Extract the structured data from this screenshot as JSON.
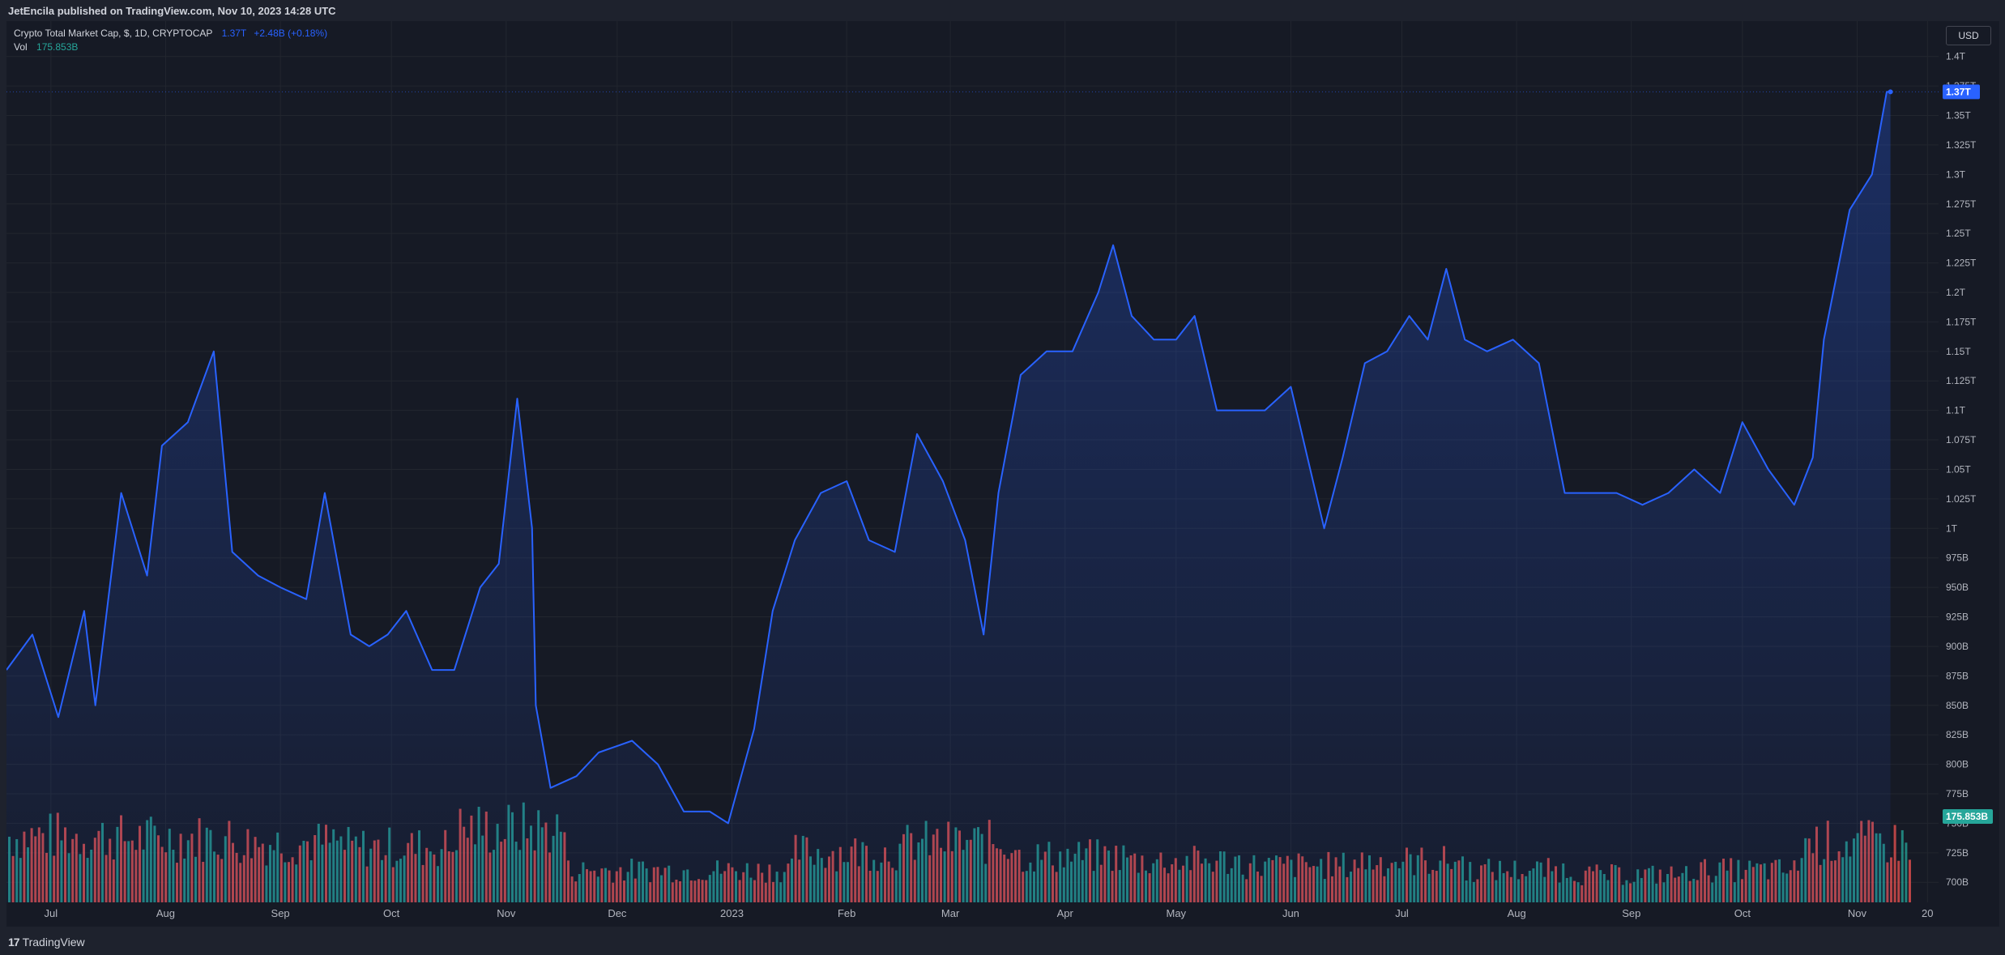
{
  "header": {
    "publish_text": "JetEncila published on TradingView.com, Nov 10, 2023 14:28 UTC"
  },
  "legend": {
    "symbol": "Crypto Total Market Cap, $, 1D, CRYPTOCAP",
    "price": "1.37T",
    "change": "+2.48B (+0.18%)",
    "vol_label": "Vol",
    "vol_value": "175.853B"
  },
  "controls": {
    "currency": "USD"
  },
  "footer": {
    "brand": "TradingView",
    "brand_mark": "17"
  },
  "colors": {
    "line": "#2962ff",
    "up": "#26a69a",
    "down": "#ef5350",
    "background": "#161a25",
    "grid": "#22262f"
  },
  "chart_data": {
    "type": "area",
    "title": "Crypto Total Market Cap, $, 1D, CRYPTOCAP",
    "y_axis": {
      "unit": "USD",
      "ticks": [
        "1.4T",
        "1.375T",
        "1.35T",
        "1.325T",
        "1.3T",
        "1.275T",
        "1.25T",
        "1.225T",
        "1.2T",
        "1.175T",
        "1.15T",
        "1.125T",
        "1.1T",
        "1.075T",
        "1.05T",
        "1.025T",
        "1T",
        "975B",
        "950B",
        "925B",
        "900B",
        "875B",
        "850B",
        "825B",
        "800B",
        "775B",
        "750B",
        "725B",
        "700B"
      ],
      "tick_values": [
        1.4,
        1.375,
        1.35,
        1.325,
        1.3,
        1.275,
        1.25,
        1.225,
        1.2,
        1.175,
        1.15,
        1.125,
        1.1,
        1.075,
        1.05,
        1.025,
        1.0,
        0.975,
        0.95,
        0.925,
        0.9,
        0.875,
        0.85,
        0.825,
        0.8,
        0.775,
        0.75,
        0.725,
        0.7
      ],
      "range": [
        0.683,
        1.43
      ]
    },
    "x_axis": {
      "labels": [
        "Jul",
        "Aug",
        "Sep",
        "Oct",
        "Nov",
        "Dec",
        "2023",
        "Feb",
        "Mar",
        "Apr",
        "May",
        "Jun",
        "Jul",
        "Aug",
        "Sep",
        "Oct",
        "Nov",
        "20"
      ],
      "label_dates": [
        "2022-07-01",
        "2022-08-01",
        "2022-09-01",
        "2022-10-01",
        "2022-11-01",
        "2022-12-01",
        "2023-01-01",
        "2023-02-01",
        "2023-03-01",
        "2023-04-01",
        "2023-05-01",
        "2023-06-01",
        "2023-07-01",
        "2023-08-01",
        "2023-09-01",
        "2023-10-01",
        "2023-11-01",
        "2023-11-20"
      ],
      "range": [
        "2022-06-19",
        "2023-11-23"
      ]
    },
    "last_value_label": "1.37T",
    "last_value": 1.37,
    "volume_label": "175.853B",
    "series": [
      {
        "name": "Crypto Total Market Cap",
        "unit": "trillion USD",
        "x": [
          "2022-06-19",
          "2022-06-26",
          "2022-07-03",
          "2022-07-10",
          "2022-07-13",
          "2022-07-20",
          "2022-07-27",
          "2022-07-31",
          "2022-08-07",
          "2022-08-14",
          "2022-08-19",
          "2022-08-26",
          "2022-09-01",
          "2022-09-08",
          "2022-09-13",
          "2022-09-20",
          "2022-09-25",
          "2022-09-30",
          "2022-10-05",
          "2022-10-12",
          "2022-10-18",
          "2022-10-25",
          "2022-10-30",
          "2022-11-04",
          "2022-11-08",
          "2022-11-09",
          "2022-11-13",
          "2022-11-20",
          "2022-11-26",
          "2022-12-05",
          "2022-12-12",
          "2022-12-19",
          "2022-12-26",
          "2022-12-31",
          "2023-01-07",
          "2023-01-12",
          "2023-01-18",
          "2023-01-25",
          "2023-02-01",
          "2023-02-07",
          "2023-02-14",
          "2023-02-20",
          "2023-02-27",
          "2023-03-05",
          "2023-03-10",
          "2023-03-14",
          "2023-03-20",
          "2023-03-27",
          "2023-04-03",
          "2023-04-10",
          "2023-04-14",
          "2023-04-19",
          "2023-04-25",
          "2023-05-01",
          "2023-05-06",
          "2023-05-12",
          "2023-05-18",
          "2023-05-25",
          "2023-06-01",
          "2023-06-07",
          "2023-06-10",
          "2023-06-15",
          "2023-06-21",
          "2023-06-27",
          "2023-07-03",
          "2023-07-08",
          "2023-07-13",
          "2023-07-18",
          "2023-07-24",
          "2023-07-31",
          "2023-08-07",
          "2023-08-14",
          "2023-08-17",
          "2023-08-22",
          "2023-08-28",
          "2023-09-04",
          "2023-09-11",
          "2023-09-18",
          "2023-09-25",
          "2023-10-01",
          "2023-10-08",
          "2023-10-15",
          "2023-10-20",
          "2023-10-23",
          "2023-10-30",
          "2023-11-05",
          "2023-11-09",
          "2023-11-10"
        ],
        "values": [
          0.88,
          0.91,
          0.84,
          0.93,
          0.85,
          1.03,
          0.96,
          1.07,
          1.09,
          1.15,
          0.98,
          0.96,
          0.95,
          0.94,
          1.03,
          0.91,
          0.9,
          0.91,
          0.93,
          0.88,
          0.88,
          0.95,
          0.97,
          1.11,
          1.0,
          0.85,
          0.78,
          0.79,
          0.81,
          0.82,
          0.8,
          0.76,
          0.76,
          0.75,
          0.83,
          0.93,
          0.99,
          1.03,
          1.04,
          0.99,
          0.98,
          1.08,
          1.04,
          0.99,
          0.91,
          1.03,
          1.13,
          1.15,
          1.15,
          1.2,
          1.24,
          1.18,
          1.16,
          1.16,
          1.18,
          1.1,
          1.1,
          1.1,
          1.12,
          1.04,
          1.0,
          1.06,
          1.14,
          1.15,
          1.18,
          1.16,
          1.22,
          1.16,
          1.15,
          1.16,
          1.14,
          1.03,
          1.03,
          1.03,
          1.03,
          1.02,
          1.03,
          1.05,
          1.03,
          1.09,
          1.05,
          1.02,
          1.06,
          1.16,
          1.27,
          1.3,
          1.37,
          1.37
        ]
      },
      {
        "name": "Vol",
        "unit": "relative volume (fraction of max bar)",
        "x": [
          "2022-07",
          "2022-08",
          "2022-09",
          "2022-10",
          "2022-11",
          "2022-12",
          "2023-01",
          "2023-02",
          "2023-03",
          "2023-04",
          "2023-05",
          "2023-06",
          "2023-07",
          "2023-08",
          "2023-09",
          "2023-10",
          "2023-11"
        ],
        "values": [
          0.72,
          0.7,
          0.65,
          0.6,
          0.8,
          0.35,
          0.35,
          0.55,
          0.65,
          0.5,
          0.45,
          0.4,
          0.45,
          0.35,
          0.3,
          0.35,
          0.65
        ]
      }
    ]
  }
}
